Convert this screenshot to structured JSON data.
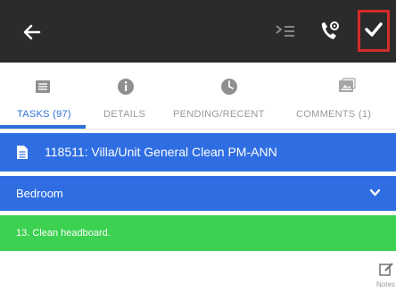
{
  "tabs": [
    {
      "label": "TASKS (97)",
      "icon": "list-icon",
      "active": true
    },
    {
      "label": "DETAILS",
      "icon": "info-icon",
      "active": false
    },
    {
      "label": "PENDING/RECENT",
      "icon": "clock-icon",
      "active": false
    },
    {
      "label": "COMMENTS (1)",
      "icon": "image-icon",
      "active": false
    }
  ],
  "task": {
    "title": "118511: Villa/Unit General Clean PM-ANN"
  },
  "section": {
    "label": "Bedroom"
  },
  "item": {
    "label": "13. Clean headboard."
  },
  "notes": {
    "label": "Notes"
  },
  "colors": {
    "header": "#2b2b2b",
    "accent": "#2d6fd6",
    "blue": "#2f6ee2",
    "green": "#3cd150",
    "highlight": "#d42b2b"
  }
}
